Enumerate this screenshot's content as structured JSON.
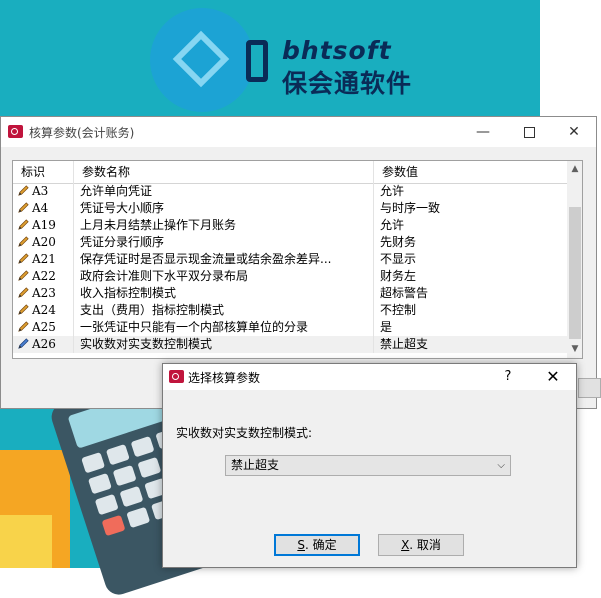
{
  "brand": {
    "en": "bhtsoft",
    "cn": "保会通软件"
  },
  "window": {
    "title": "核算参数(会计账务)",
    "controls": {
      "minimize": "—",
      "close": "✕"
    }
  },
  "table": {
    "columns": [
      "标识",
      "参数名称",
      "参数值"
    ],
    "rows": [
      {
        "code": "A3",
        "name": "允许单向凭证",
        "value": "允许"
      },
      {
        "code": "A4",
        "name": "凭证号大小顺序",
        "value": "与时序一致"
      },
      {
        "code": "A19",
        "name": "上月未月结禁止操作下月账务",
        "value": "允许"
      },
      {
        "code": "A20",
        "name": "凭证分录行顺序",
        "value": "先财务"
      },
      {
        "code": "A21",
        "name": "保存凭证时是否显示现金流量或结余盈余差异...",
        "value": "不显示"
      },
      {
        "code": "A22",
        "name": "政府会计准则下水平双分录布局",
        "value": "财务左"
      },
      {
        "code": "A23",
        "name": "收入指标控制模式",
        "value": "超标警告"
      },
      {
        "code": "A24",
        "name": "支出（费用）指标控制模式",
        "value": "不控制"
      },
      {
        "code": "A25",
        "name": "一张凭证中只能有一个内部核算单位的分录",
        "value": "是"
      },
      {
        "code": "A26",
        "name": "实收数对实支数控制模式",
        "value": "禁止超支"
      }
    ],
    "selected_row": "A26"
  },
  "dialog": {
    "title": "选择核算参数",
    "help": "?",
    "close": "✕",
    "prompt": "实收数对实支数控制模式:",
    "selected_option": "禁止超支",
    "ok": {
      "key": "S",
      "label": ". 确定"
    },
    "cancel": {
      "key": "X",
      "label": ". 取消"
    }
  },
  "colors": {
    "teal_bg": "#19aebf",
    "brand_navy": "#0a2b57",
    "app_icon": "#c0143c",
    "focus_blue": "#0078d7"
  },
  "icons": {
    "row_icon": "pen-icon",
    "app_icon": "key-icon"
  }
}
